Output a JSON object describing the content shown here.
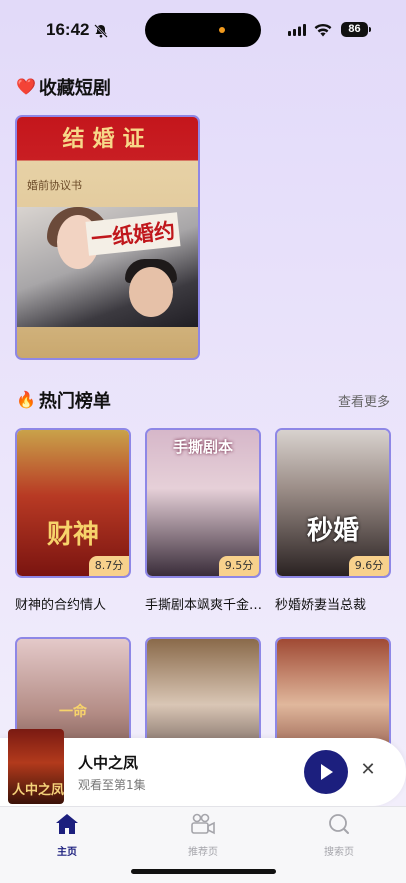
{
  "status_bar": {
    "time": "16:42",
    "battery": "86"
  },
  "favorites": {
    "title": "收藏短剧",
    "title_icon": "heart-icon",
    "card": {
      "poster_header": "结婚证",
      "poster_sub": "婚前协议书",
      "poster_title": "一纸婚约"
    }
  },
  "hot": {
    "title": "热门榜单",
    "title_icon": "fire-icon",
    "more": "查看更多",
    "items": [
      {
        "name": "财神的合约情人",
        "score": "8.7分",
        "poster_text": "财神"
      },
      {
        "name": "手撕剧本飒爽千金美爆了",
        "score": "9.5分",
        "poster_text": "手撕剧本"
      },
      {
        "name": "秒婚娇妻当总裁",
        "score": "9.6分",
        "poster_text": "秒婚"
      }
    ],
    "row2": [
      {
        "poster_text": "一命"
      },
      {
        "poster_text": ""
      },
      {
        "poster_text": ""
      }
    ]
  },
  "mini_player": {
    "title": "人中之凤",
    "subtitle": "观看至第1集",
    "thumb_text": "人中之凤"
  },
  "tabs": [
    {
      "label": "主页",
      "icon": "home-icon",
      "active": true
    },
    {
      "label": "推荐页",
      "icon": "video-camera-icon",
      "active": false
    },
    {
      "label": "搜索页",
      "icon": "search-icon",
      "active": false
    }
  ],
  "colors": {
    "accent": "#1c1f7e",
    "card_border": "#8e87e6",
    "score_bg": "#f8d18c",
    "bg_top": "#e2daf9"
  }
}
